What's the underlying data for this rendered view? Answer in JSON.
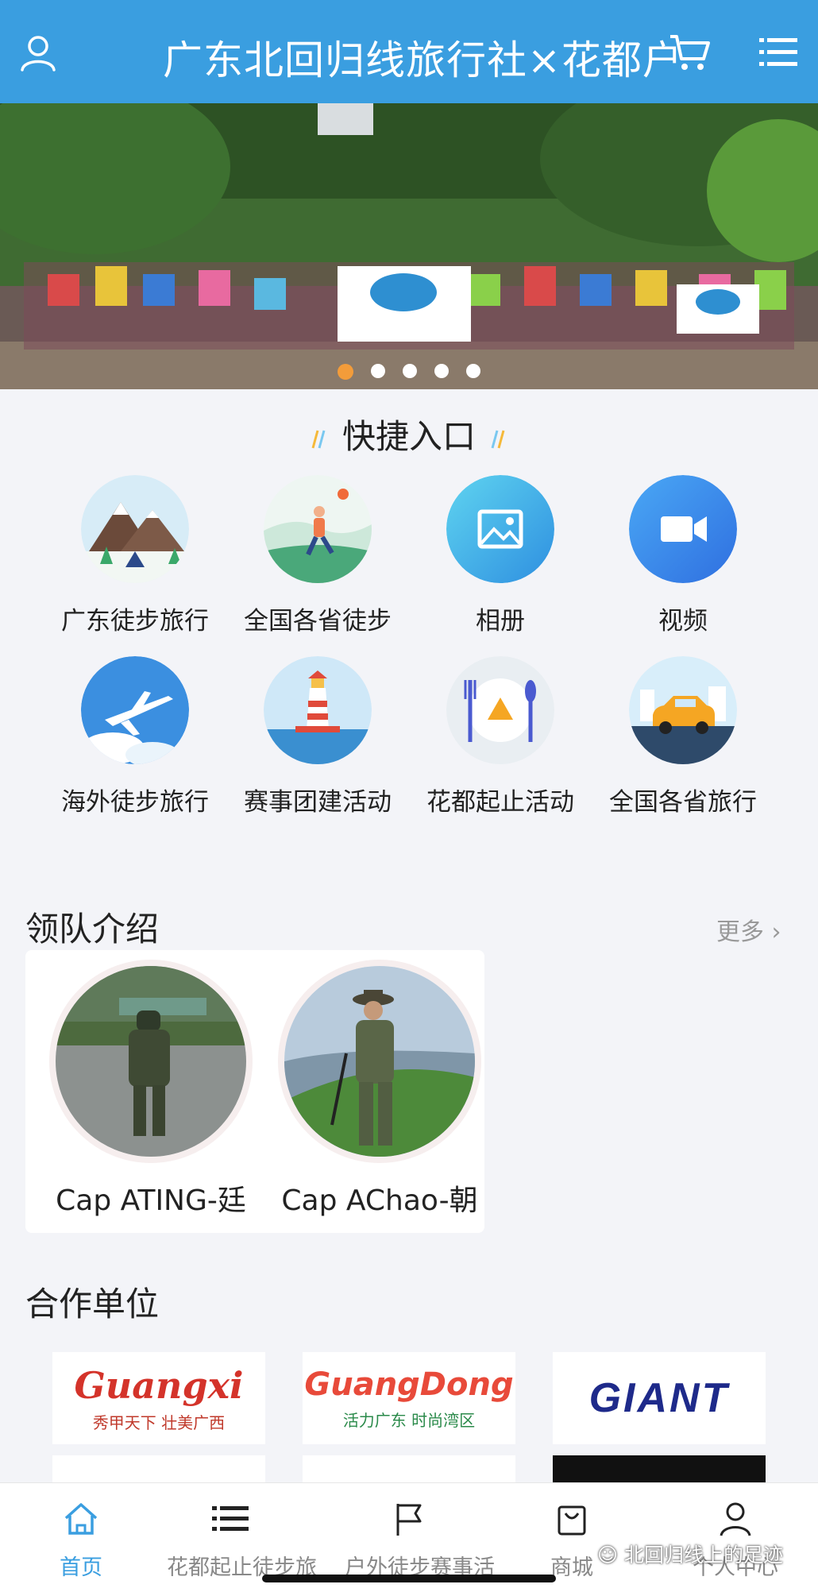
{
  "header": {
    "title": "广东北回归线旅行社×花都户",
    "icons": [
      "user-icon",
      "cart-icon",
      "menu-icon"
    ],
    "color": "#3a9ee0"
  },
  "banner": {
    "slide_count": 5,
    "active_slide": 1
  },
  "quick_entry": {
    "title": "快捷入口",
    "items": [
      {
        "label": "广东徒步旅行",
        "icon": "mountain-camp-icon"
      },
      {
        "label": "全国各省徒步",
        "icon": "runner-icon"
      },
      {
        "label": "相册",
        "icon": "photo-album-icon"
      },
      {
        "label": "视频",
        "icon": "video-camera-icon"
      },
      {
        "label": "海外徒步旅行",
        "icon": "airplane-icon"
      },
      {
        "label": "赛事团建活动",
        "icon": "lighthouse-icon"
      },
      {
        "label": "花都起止活动",
        "icon": "dining-icon"
      },
      {
        "label": "全国各省旅行",
        "icon": "car-icon"
      }
    ]
  },
  "leaders": {
    "title": "领队介绍",
    "more_label": "更多",
    "items": [
      {
        "name": "Cap ATING-廷"
      },
      {
        "name": "Cap AChao-朝"
      }
    ]
  },
  "partners": {
    "title": "合作单位",
    "items": [
      {
        "logo_text": "Guangxi",
        "tagline": "秀甲天下 壮美广西"
      },
      {
        "logo_text": "GuangDong",
        "tagline": "活力广东 时尚湾区"
      },
      {
        "logo_text": "GIANT",
        "tagline": ""
      }
    ]
  },
  "tabbar": {
    "items": [
      {
        "label": "首页",
        "icon": "home-icon",
        "active": true
      },
      {
        "label": "花都起止徒步旅",
        "icon": "list-icon",
        "active": false
      },
      {
        "label": "户外徒步赛事活",
        "icon": "flag-icon",
        "active": false
      },
      {
        "label": "商城",
        "icon": "shopping-bag-icon",
        "active": false
      },
      {
        "label": "个人中心",
        "icon": "person-icon",
        "active": false
      }
    ]
  },
  "watermark": {
    "text": "北回归线上的足迹"
  }
}
